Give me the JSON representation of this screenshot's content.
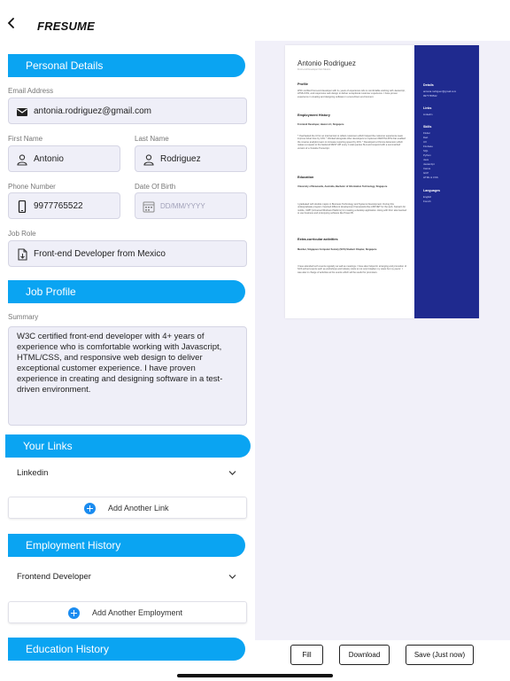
{
  "app": {
    "title": "FRESUME"
  },
  "sections": {
    "personal": "Personal Details",
    "job": "Job Profile",
    "links": "Your Links",
    "employment": "Employment History",
    "education": "Education History"
  },
  "fields": {
    "email_label": "Email Address",
    "email": "antonia.rodriguez@gmail.com",
    "first_label": "First Name",
    "first": "Antonio",
    "last_label": "Last Name",
    "last": "Rodriguez",
    "phone_label": "Phone Number",
    "phone": "9977765522",
    "dob_label": "Date Of Birth",
    "dob_placeholder": "DD/MM/YYYY",
    "role_label": "Job Role",
    "role": "Front-end Developer from Mexico",
    "summary_label": "Summary",
    "summary": "W3C certified front-end developer with 4+ years of experience who is comfortable working with Javascript, HTML/CSS, and responsive web design to deliver exceptional customer experience. I have proven experience in creating and designing software in a test-driven environment."
  },
  "links": {
    "item": "Linkedin",
    "add_label": "Add Another Link"
  },
  "employment": {
    "item": "Frontend Developer",
    "add_label": "Add Another Employment"
  },
  "actions": {
    "fill": "Fill",
    "download": "Download",
    "save": "Save (Just now)"
  },
  "resume": {
    "name": "Antonio Rodriguez",
    "subtitle": "Front-end Developer from Mexico",
    "profile_h": "Profile",
    "profile": "W3C certified front-end developer with 4+ years of experience who is comfortable working with Javascript, HTML/CSS, and responsive web design to deliver exceptional customer experience. I have proven experience in creating and designing software in a test-driven environment.",
    "emp_h": "Employment History",
    "emp_title": "Frontend Developer, Hewa LLC, Singapore",
    "emp_text": "* Overhauled the UI for an internal tool to reflect customers which helped the customer experience team improve ticket time by 14%. * Worked alongside other developers to implement RESTful APIs that enabled the reverse analytics team to increase reporting speed by 24%. * Developed a Chrome Extension which makes a request to the backend REST API every 4 wait queries SLA and respond with a summarized version of a Youtube Transcript.",
    "edu_h": "Education",
    "edu_title": "University of Newcastle, Australia, Bachelor of Information Technology, Singapore",
    "edu_text": "I graduated with double majors in Business Technology and Systems Development. During this undergraduate program I learned different development frameworks like ASP.NET for the web, Xamarin for mobile, UWP (Universal Windows Platform) for creating a desktop application. Along with this I also learned to use business and prototyping software like Power BI.",
    "extra_h": "Extra-curricular activities",
    "extra_title": "Member, Singapore Computer Society (SCS) Student Chapter, Singapore",
    "extra_text": "I have attended tech events regularly as well as meetings. I have also helped in arranging and promotion of SCS school events such as workshops and industry visits to not only broaden my views but my peers'. I was also in charge of activities at the events which will be useful for promoters.",
    "details_h": "Details",
    "details": [
      "antonia.rodriguez@gmail.com",
      "9977765522"
    ],
    "links_h": "Links",
    "links": [
      "Linkedin"
    ],
    "skills_h": "Skills",
    "skills": [
      "Flutter",
      "Dart",
      "UX",
      "Firebase",
      "SQL",
      "Python",
      "Java",
      "Javascript",
      "Canva",
      "GCP",
      "HTML & CSS"
    ],
    "lang_h": "Languages",
    "langs": [
      "English",
      "French"
    ]
  },
  "colors": {
    "accent": "#0aa4f2",
    "sidebar": "#1f2a8f",
    "plus": "#1a8cf0"
  }
}
